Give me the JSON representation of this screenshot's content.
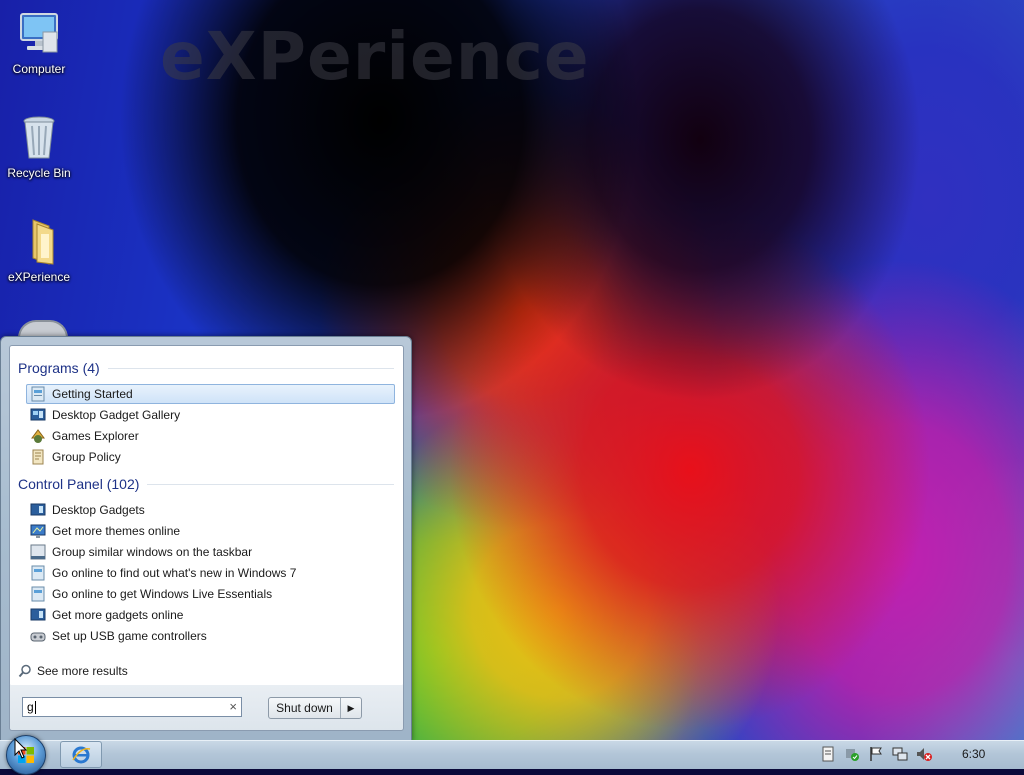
{
  "desktop": {
    "brand": "eXPerience",
    "icons": [
      {
        "label": "Computer",
        "icon": "computer-icon"
      },
      {
        "label": "Recycle Bin",
        "icon": "recycle-bin-icon"
      },
      {
        "label": "eXPerience",
        "icon": "folder-icon"
      }
    ]
  },
  "start_menu": {
    "programs_header": "Programs (4)",
    "programs": [
      {
        "label": "Getting Started",
        "icon": "getting-started-icon",
        "selected": true
      },
      {
        "label": "Desktop Gadget Gallery",
        "icon": "gadget-gallery-icon"
      },
      {
        "label": "Games Explorer",
        "icon": "games-explorer-icon"
      },
      {
        "label": "Group Policy",
        "icon": "group-policy-icon"
      }
    ],
    "control_panel_header": "Control Panel (102)",
    "control_panel": [
      {
        "label": "Desktop Gadgets",
        "icon": "desktop-gadgets-icon"
      },
      {
        "label": "Get more themes online",
        "icon": "personalization-icon"
      },
      {
        "label": "Group similar windows on the taskbar",
        "icon": "taskbar-icon"
      },
      {
        "label": "Go online to find out what's new in Windows 7",
        "icon": "getting-started-icon"
      },
      {
        "label": "Go online to get Windows Live Essentials",
        "icon": "getting-started-icon"
      },
      {
        "label": "Get more gadgets online",
        "icon": "desktop-gadgets-icon"
      },
      {
        "label": "Set up USB game controllers",
        "icon": "game-controller-icon"
      }
    ],
    "see_more": "See more results",
    "search_value": "g",
    "clear_symbol": "×",
    "shutdown_label": "Shut down",
    "shutdown_arrow": "▶"
  },
  "taskbar": {
    "pinned": [
      {
        "icon": "internet-explorer-icon"
      }
    ],
    "tray": [
      "action-center-icon",
      "security-icon",
      "flag-icon",
      "network-icon",
      "volume-muted-icon"
    ],
    "clock": "6:30"
  },
  "colors": {
    "section_header": "#1e3287",
    "selection": "#cfe3f8"
  }
}
